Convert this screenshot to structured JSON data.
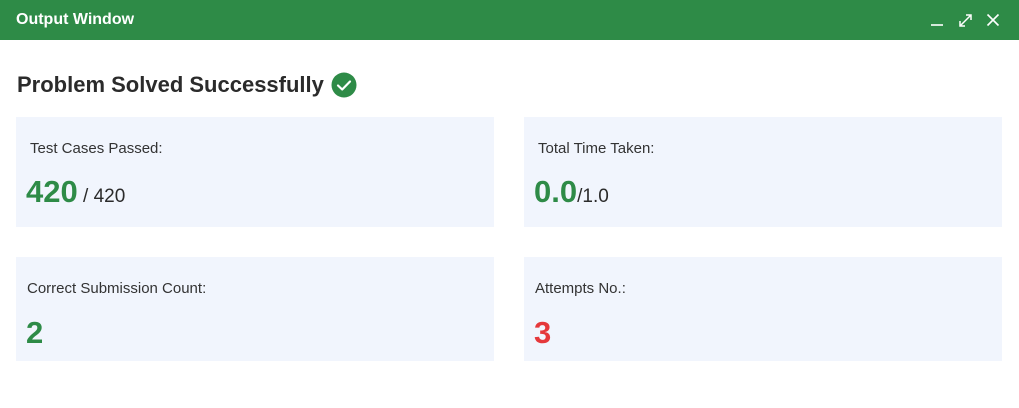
{
  "window": {
    "title": "Output Window"
  },
  "heading": "Problem Solved Successfully",
  "cards": {
    "test_cases": {
      "label": "Test Cases Passed:",
      "value": "420",
      "total": " / 420"
    },
    "time": {
      "label": "Total Time Taken:",
      "value": "0.0",
      "total": "/1.0"
    },
    "correct_count": {
      "label": "Correct Submission Count:",
      "value": "2"
    },
    "attempts": {
      "label": "Attempts No.:",
      "value": "3"
    }
  },
  "colors": {
    "titlebar": "#2e8b47",
    "success": "#2e8b47",
    "attempts": "#e5383b",
    "card_bg": "#f1f5fd"
  },
  "icons": [
    "minimize-icon",
    "maximize-icon",
    "close-icon",
    "check-circle-icon"
  ]
}
